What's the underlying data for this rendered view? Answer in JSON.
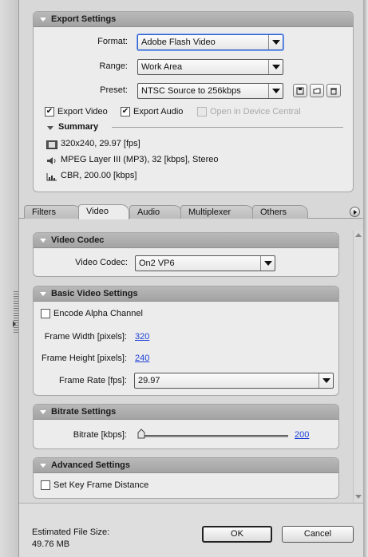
{
  "export_settings": {
    "title": "Export Settings",
    "format_label": "Format:",
    "format_value": "Adobe Flash Video",
    "range_label": "Range:",
    "range_value": "Work Area",
    "preset_label": "Preset:",
    "preset_value": "NTSC Source to 256kbps",
    "export_video": {
      "label": "Export Video",
      "checked": true
    },
    "export_audio": {
      "label": "Export Audio",
      "checked": true
    },
    "open_device_central": {
      "label": "Open in Device Central",
      "checked": false,
      "enabled": false
    },
    "summary": {
      "title": "Summary",
      "video": "320x240, 29.97 [fps]",
      "audio": "MPEG Layer III (MP3), 32 [kbps], Stereo",
      "bitrate": "CBR, 200.00 [kbps]"
    }
  },
  "tabs": [
    "Filters",
    "Video",
    "Audio",
    "Multiplexer",
    "Others"
  ],
  "active_tab": "Video",
  "video_codec": {
    "title": "Video Codec",
    "label": "Video Codec:",
    "value": "On2 VP6"
  },
  "basic_video": {
    "title": "Basic Video Settings",
    "encode_alpha": {
      "label": "Encode Alpha Channel",
      "checked": false
    },
    "frame_width_label": "Frame Width [pixels]:",
    "frame_width": "320",
    "frame_height_label": "Frame Height [pixels]:",
    "frame_height": "240",
    "frame_rate_label": "Frame Rate [fps]:",
    "frame_rate": "29.97"
  },
  "bitrate": {
    "title": "Bitrate Settings",
    "label": "Bitrate [kbps]:",
    "value": "200",
    "slider_fraction": 0.0
  },
  "advanced": {
    "title": "Advanced Settings",
    "set_key_frame": {
      "label": "Set Key Frame Distance",
      "checked": false
    }
  },
  "footer": {
    "estimated_label": "Estimated File Size:",
    "estimated_value": "49.76 MB",
    "ok_label": "OK",
    "cancel_label": "Cancel"
  },
  "colors": {
    "link": "#1c3fd8",
    "focus": "#2d5dc9",
    "panel_header": "#a3a3a3"
  }
}
